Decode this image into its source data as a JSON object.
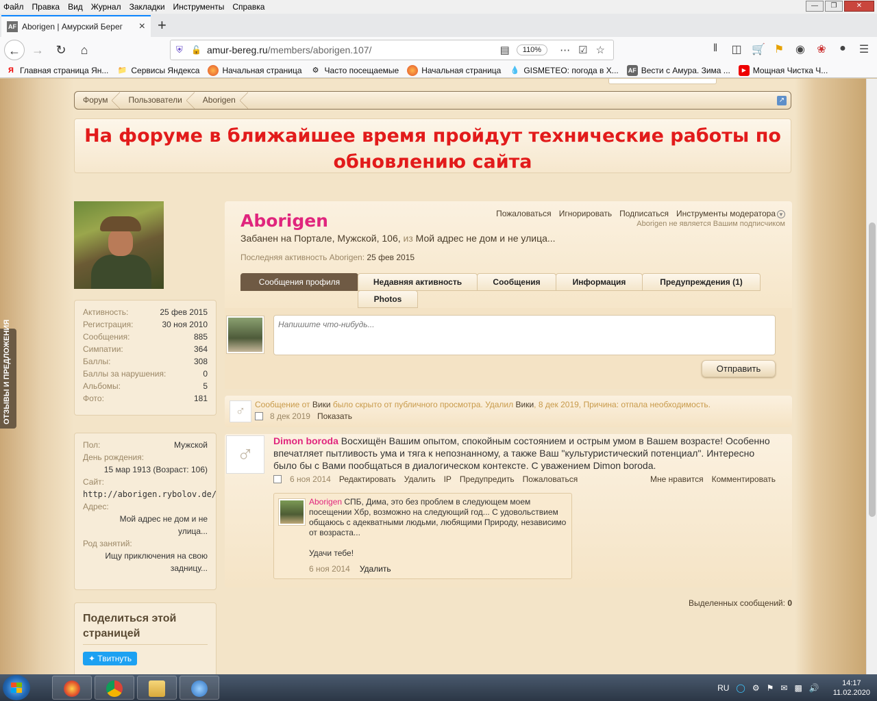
{
  "menubar": {
    "items": [
      "Файл",
      "Правка",
      "Вид",
      "Журнал",
      "Закладки",
      "Инструменты",
      "Справка"
    ]
  },
  "tab": {
    "title": "Aborigen | Амурский Берег",
    "favicon_text": "AF"
  },
  "urlbar": {
    "host": "amur-bereg.ru",
    "path": "/members/aborigen.107/",
    "zoom": "110%"
  },
  "bookmarks": [
    {
      "label": "Главная страница Ян...",
      "icon": "yandex-icon"
    },
    {
      "label": "Сервисы Яндекса",
      "icon": "folder-icon"
    },
    {
      "label": "Начальная страница",
      "icon": "firefox-icon"
    },
    {
      "label": "Часто посещаемые",
      "icon": "gear-icon"
    },
    {
      "label": "Начальная страница",
      "icon": "firefox-icon"
    },
    {
      "label": "GISMETEO: погода в Х...",
      "icon": "drop-icon"
    },
    {
      "label": "Вести с Амура. Зима ...",
      "icon": "af-icon"
    },
    {
      "label": "Мощная Чистка Ч...",
      "icon": "youtube-icon"
    }
  ],
  "breadcrumb": [
    "Форум",
    "Пользователи",
    "Aborigen"
  ],
  "notice": {
    "line1": "На форуме в ближайшее время пройдут технические работы по",
    "line2": "обновлению сайта"
  },
  "feedback_tab": "ОТЗЫВЫ И ПРЕДЛОЖЕНИЯ",
  "stats": [
    {
      "k": "Активность:",
      "v": "25 фев 2015"
    },
    {
      "k": "Регистрация:",
      "v": "30 ноя 2010"
    },
    {
      "k": "Сообщения:",
      "v": "885"
    },
    {
      "k": "Симпатии:",
      "v": "364"
    },
    {
      "k": "Баллы:",
      "v": "308"
    },
    {
      "k": "Баллы за нарушения:",
      "v": "0"
    },
    {
      "k": "Альбомы:",
      "v": "5"
    },
    {
      "k": "Фото:",
      "v": "181"
    }
  ],
  "info": {
    "gender_k": "Пол:",
    "gender_v": "Мужской",
    "bday_k": "День рождения:",
    "bday_v": "15 мар 1913 (Возраст: 106)",
    "site_k": "Сайт:",
    "site_v": "http://aborigen.rybolov.de/",
    "addr_k": "Адрес:",
    "addr_v1": "Мой адрес не дом и не",
    "addr_v2": "улица...",
    "occ_k": "Род занятий:",
    "occ_v1": "Ищу приключения на свою",
    "occ_v2": "задницу..."
  },
  "share": {
    "heading1": "Поделиться этой",
    "heading2": "страницей",
    "tweet": "Твитнуть"
  },
  "profile": {
    "name": "Aborigen",
    "subtitle_main": "Забанен на Портале, Мужской, 106,",
    "subtitle_from": "из",
    "subtitle_loc": "Мой адрес не дом и не улица...",
    "last_label": "Последняя активность Aborigen:",
    "last_date": "25 фев 2015",
    "links": [
      "Пожаловаться",
      "Игнорировать",
      "Подписаться",
      "Инструменты модератора"
    ],
    "sub_note": "Aborigen не является Вашим подписчиком"
  },
  "tabs": [
    "Сообщения профиля",
    "Недавняя активность",
    "Сообщения",
    "Информация",
    "Предупреждения (1)",
    "Photos"
  ],
  "postbox": {
    "placeholder": "Напишите что-нибудь...",
    "send": "Отправить"
  },
  "deleted": {
    "prefix": "Сообщение от",
    "author": "Вики",
    "mid": "было скрыто от публичного просмотра. Удалил",
    "by": "Вики",
    "tail": ", 8 дек 2019, Причина: отпала необходимость.",
    "date": "8 дек 2019",
    "show": "Показать"
  },
  "post": {
    "author": "Dimon boroda",
    "text": "Восхищён Вашим опытом, спокойным состоянием и острым умом в Вашем возрасте! Особенно впечатляет пытливость ума и тяга к непознанному, а также Ваш \"культуристический потенциал\". Интересно было бы с Вами пообщаться в диалогическом контексте. С уважением Dimon boroda.",
    "date": "6 ноя 2014",
    "actions": [
      "Редактировать",
      "Удалить",
      "IP",
      "Предупредить",
      "Пожаловаться"
    ],
    "right_actions": [
      "Мне нравится",
      "Комментировать"
    ]
  },
  "comment": {
    "author": "Aborigen",
    "text": "СПБ, Дима, это без проблем в следующем моем посещении Хбр, возможно на следующий год... С удовольствием общаюсь с адекватными людьми, любящими Природу, независимо от возраста...",
    "text2": "Удачи тебе!",
    "date": "6 ноя 2014",
    "delete": "Удалить"
  },
  "selected": {
    "label": "Выделенных сообщений:",
    "count": "0"
  },
  "taskbar": {
    "lang": "RU",
    "time": "14:17",
    "date": "11.02.2020"
  },
  "colors": {
    "username": "#e0257d",
    "notice": "#e21b1b",
    "tab_active": "#6f5a44"
  }
}
